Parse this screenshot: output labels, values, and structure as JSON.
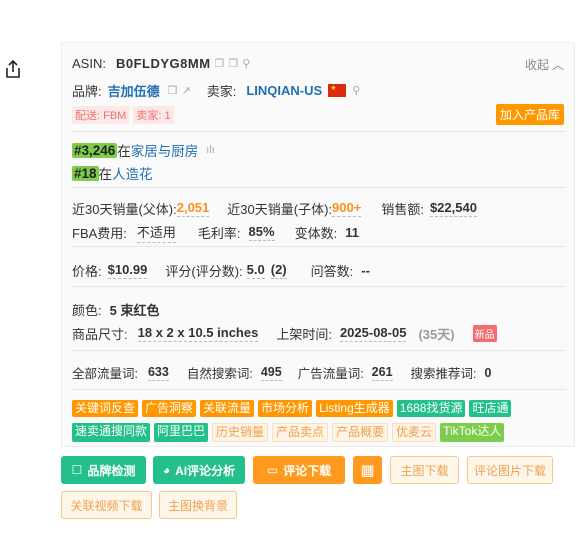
{
  "product": {
    "asin_label": "ASIN:",
    "asin": "B0FLDYG8MM",
    "collapse_label": "收起",
    "brand_label": "品牌:",
    "brand": "吉加伍德",
    "seller_label": "卖家:",
    "seller": "LINQIAN-US",
    "fulfillment_tag": "配送:  FBM",
    "seller_count_tag": "卖家: 1",
    "add_to_library": "加入产品库",
    "ranks": [
      {
        "rank": "#3,246",
        "prefix": "在",
        "category": "家居与厨房"
      },
      {
        "rank": "#18",
        "prefix": "在",
        "category": "人造花"
      }
    ]
  },
  "metrics": {
    "sales30_parent_label": "近30天销量(父体):",
    "sales30_parent": "2,051",
    "sales30_child_label": "近30天销量(子体):",
    "sales30_child": "900+",
    "revenue_label": "销售额:",
    "revenue": "$22,540",
    "fba_label": "FBA费用:",
    "fba": "不适用",
    "margin_label": "毛利率:",
    "margin": "85%",
    "variants_label": "变体数:",
    "variants": "11",
    "price_label": "价格:",
    "price": "$10.99",
    "rating_label": "评分(评分数):",
    "rating": "5.0",
    "rating_count": "(2)",
    "qa_label": "问答数:",
    "qa": "--",
    "color_label": "颜色:",
    "color": "5 束红色",
    "size_label": "商品尺寸:",
    "size": "18 x 2 x 10.5 inches",
    "listed_label": "上架时间:",
    "listed_date": "2025-08-05",
    "listed_days": "(35天)",
    "new_badge": "新品",
    "traffic_all_label": "全部流量词:",
    "traffic_all": "633",
    "organic_label": "自然搜索词:",
    "organic": "495",
    "ad_label": "广告流量词:",
    "ad": "261",
    "recommend_label": "搜索推荐词:",
    "recommend": "0"
  },
  "tools_row1": [
    "关键词反查",
    "广告洞察",
    "关联流量",
    "市场分析",
    "Listing生成器",
    "1688找货源",
    "旺店通"
  ],
  "tools_row2": [
    "速卖通搜同款",
    "阿里巴巴",
    "历史销量",
    "产品卖点",
    "产品概要",
    "优麦云",
    "TikTok达人"
  ],
  "actions": {
    "brand_check": "品牌检测",
    "ai_review": "AI评论分析",
    "review_download": "评论下载",
    "main_image_download": "主图下载",
    "review_image_download": "评论图片下载",
    "related_video_download": "关联视频下载",
    "main_image_bg": "主图换背景"
  },
  "colors": {
    "accent_orange": "#ff9800",
    "accent_green": "#24c08a",
    "link_blue": "#1f6fb2",
    "rank_green": "#7ccd4b"
  }
}
